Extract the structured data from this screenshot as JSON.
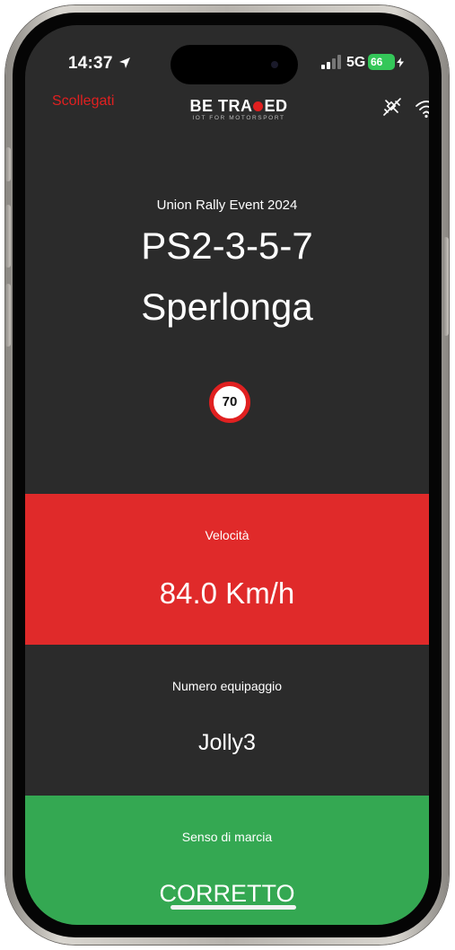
{
  "status_bar": {
    "time": "14:37",
    "network": "5G",
    "battery": "66"
  },
  "header": {
    "disconnect_label": "Scollegati",
    "logo_text_before": "BE TRA",
    "logo_text_after": "ED",
    "logo_tagline": "IOT FOR MOTORSPORT",
    "icons": [
      "satellite-off-icon",
      "wifi-icon"
    ]
  },
  "event": {
    "name": "Union Rally Event 2024",
    "stage_code": "PS2-3-5-7",
    "stage_name": "Sperlonga"
  },
  "speed_limit": {
    "value": "70"
  },
  "speed": {
    "label": "Velocità",
    "value": "84.0 Km/h"
  },
  "crew": {
    "label": "Numero equipaggio",
    "value": "Jolly3"
  },
  "direction": {
    "label": "Senso di marcia",
    "value": "CORRETTO"
  },
  "colors": {
    "background": "#2b2b2b",
    "alert_red": "#e02a2a",
    "ok_green": "#34a852",
    "battery_green": "#34c759"
  }
}
